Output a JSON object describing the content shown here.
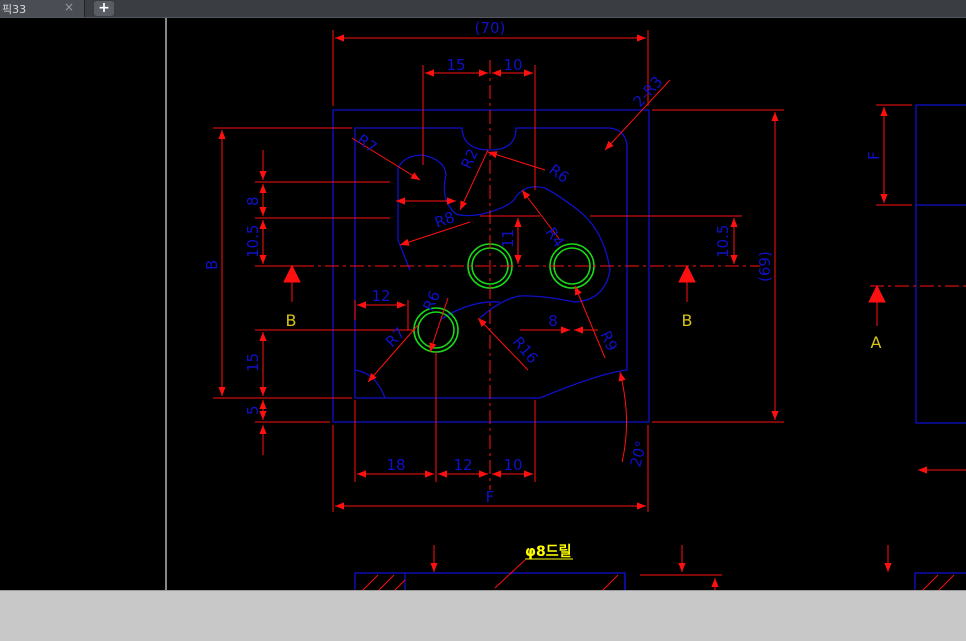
{
  "tabbar": {
    "tab_label": "픽33",
    "close_glyph": "×",
    "add_glyph": "+"
  },
  "drawing": {
    "dims": {
      "overall_width": "(70)",
      "top_15": "15",
      "top_10": "10",
      "chamfer": "2-R3",
      "r7_topleft": "R7",
      "r2": "R2",
      "r6": "R6",
      "r8": "R8",
      "r4": "R4",
      "dim_8_left": "8",
      "dim_10_5_left": "10.5",
      "dim_B_left": "B",
      "dim_11": "11",
      "dim_10_5_right": "10.5",
      "overall_height": "(69)",
      "dim_12": "12",
      "r6_lower": "R6",
      "r7_lower": "R7",
      "dim_8_mid": "8",
      "r16": "R16",
      "r9": "R9",
      "dim_15_left": "15",
      "dim_5_left": "5",
      "angle_20": "20°",
      "bot_18": "18",
      "bot_12": "12",
      "bot_10": "10",
      "bot_F": "F",
      "side_F": "F"
    },
    "section_labels": {
      "b_left": "B",
      "b_right": "B",
      "a_right": "A"
    },
    "note": "φ8드릴"
  },
  "colors": {
    "geometry": "#1010c8",
    "dimension": "#ff1010",
    "hole": "#18d818",
    "section_label": "#d8c418",
    "note": "#ffff00",
    "border": "#b4b4b4"
  }
}
